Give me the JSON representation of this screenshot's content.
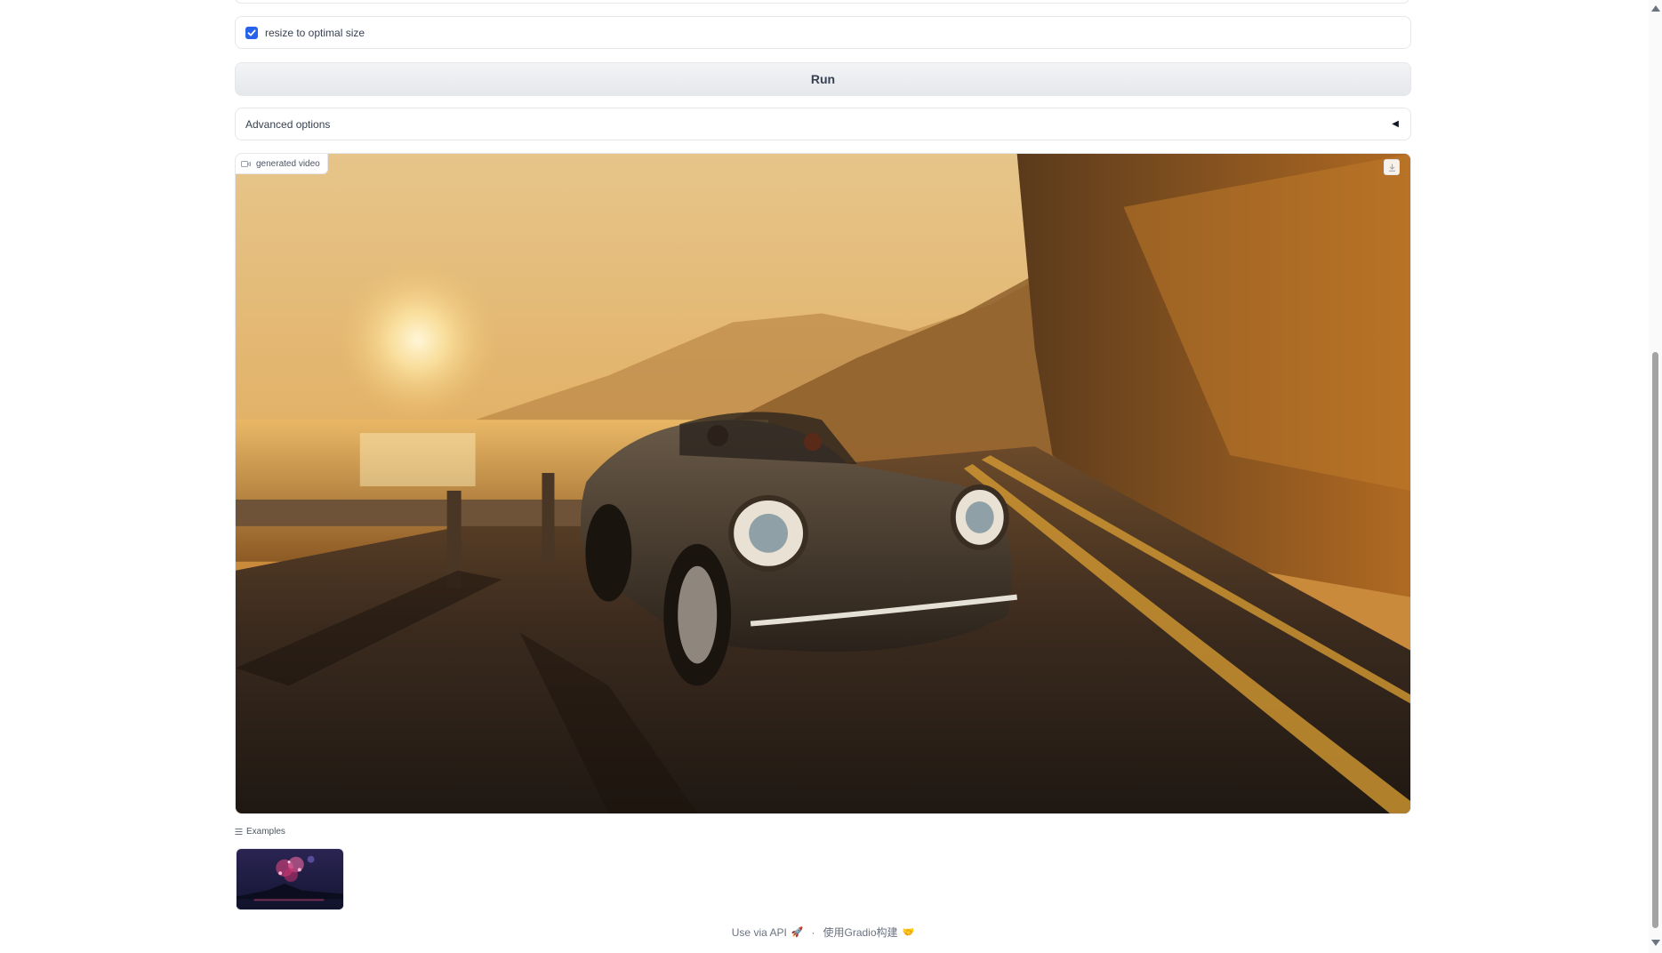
{
  "options": {
    "resize_checkbox_label": "resize to optimal size",
    "resize_checked": true
  },
  "run_button": {
    "label": "Run"
  },
  "advanced_options": {
    "label": "Advanced options",
    "arrow": "◀"
  },
  "video": {
    "label": "generated video",
    "icons": {
      "label_icon": "video-camera-icon",
      "download": "download-icon"
    }
  },
  "examples": {
    "label": "Examples",
    "icon": "list-icon",
    "items": [
      {
        "thumbnail": "fireworks-heart-night-scene"
      }
    ]
  },
  "footer": {
    "api_link": "Use via API",
    "api_glyph": "🚀",
    "separator": "·",
    "built_with": "使用Gradio构建",
    "built_glyph": "🤝"
  },
  "colors": {
    "accent": "#2563eb",
    "border": "#e5e7eb",
    "button_bg": "#e5e7eb",
    "text": "#374151"
  }
}
